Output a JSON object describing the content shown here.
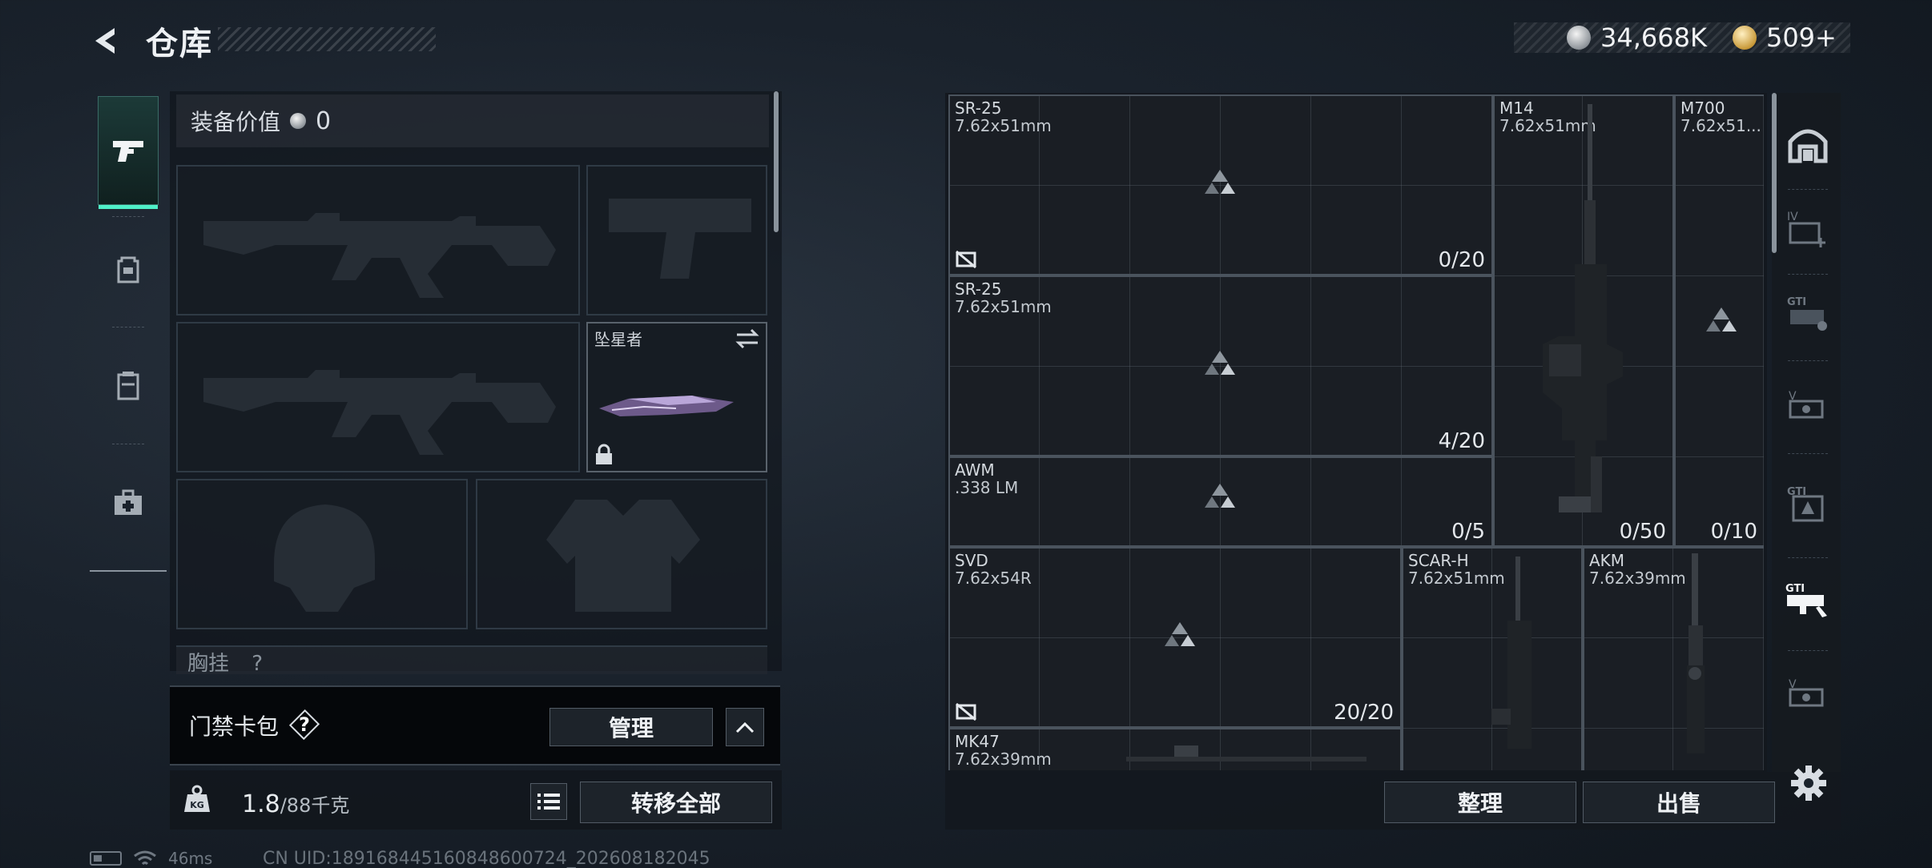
{
  "header": {
    "title": "仓库",
    "silver_amount": "34,668K",
    "gold_amount": "509+"
  },
  "left_tabs": [
    {
      "id": "weapons",
      "icon": "pistol-icon",
      "active": true
    },
    {
      "id": "backpack",
      "icon": "backpack-icon",
      "active": false
    },
    {
      "id": "container",
      "icon": "container-icon",
      "active": false
    },
    {
      "id": "medkit",
      "icon": "medkit-icon",
      "active": false
    }
  ],
  "equipment": {
    "value_label": "装备价值",
    "value": "0",
    "knife_name": "坠星者",
    "chest_label": "胸挂",
    "chest_help": "?"
  },
  "card_pack": {
    "label": "门禁卡包",
    "help": "?",
    "manage_label": "管理"
  },
  "weight": {
    "current": "1.8",
    "max": "/88千克"
  },
  "transfer_all_label": "转移全部",
  "status": {
    "ping": "46ms",
    "uid": "CN UID:18916844516084860​0724_202608182045"
  },
  "warehouse": {
    "items": [
      {
        "name": "SR-25",
        "caliber": "7.62x51mm",
        "count": "0/20",
        "placeholder": true,
        "no_image": true
      },
      {
        "name": "SR-25",
        "caliber": "7.62x51mm",
        "count": "4/20",
        "placeholder": true,
        "no_image": false
      },
      {
        "name": "AWM",
        "caliber": ".338 LM",
        "count": "0/5",
        "placeholder": true,
        "no_image": false
      },
      {
        "name": "M14",
        "caliber": "7.62x51mm",
        "count": "0/50",
        "placeholder": false
      },
      {
        "name": "M700",
        "caliber": "7.62x51...",
        "count": "0/10",
        "placeholder": true
      },
      {
        "name": "SVD",
        "caliber": "7.62x54R",
        "count": "20/20",
        "placeholder": true,
        "no_image": true
      },
      {
        "name": "SCAR-H",
        "caliber": "7.62x51mm",
        "count": "",
        "placeholder": false
      },
      {
        "name": "AKM",
        "caliber": "7.62x39mm",
        "count": "",
        "placeholder": false
      },
      {
        "name": "MK47",
        "caliber": "7.62x39mm",
        "count": "",
        "placeholder": false
      }
    ],
    "sort_label": "整理",
    "sell_label": "出售"
  },
  "right_filters": [
    {
      "id": "all",
      "icon": "all-items-icon"
    },
    {
      "id": "iv",
      "icon": "iv-armor-icon"
    },
    {
      "id": "gti-a",
      "icon": "gti-rifle-icon"
    },
    {
      "id": "v-a",
      "icon": "v-sight-icon"
    },
    {
      "id": "gti-b",
      "icon": "gti-plate-icon"
    },
    {
      "id": "gti-c",
      "icon": "gti-weapon-icon",
      "active": true
    },
    {
      "id": "v-b",
      "icon": "v-attachment-icon"
    }
  ],
  "colors": {
    "accent": "#4ff0c8",
    "panel": "#1a1e24",
    "border": "#4a535d"
  }
}
